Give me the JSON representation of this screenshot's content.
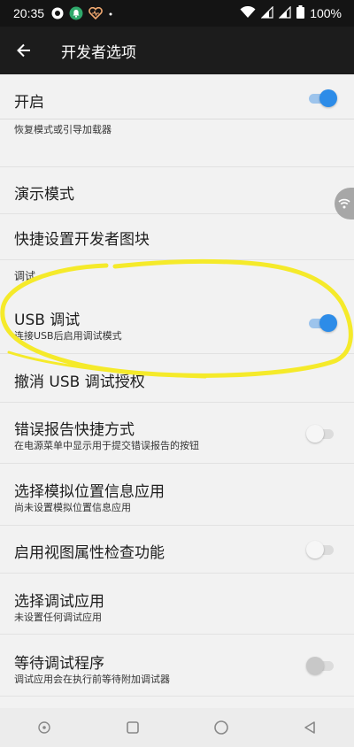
{
  "status_bar": {
    "time": "20:35",
    "battery": "100%"
  },
  "app_bar": {
    "title": "开发者选项"
  },
  "settings": {
    "enable": {
      "title": "开启",
      "on": true
    },
    "recovery_fragment": "恢复模式或引导加载器",
    "demo_mode": {
      "title": "演示模式"
    },
    "quick_tiles": {
      "title": "快捷设置开发者图块"
    },
    "debug_section": "调试",
    "usb_debug": {
      "title": "USB 调试",
      "summary": "连接USB后启用调试模式",
      "on": true
    },
    "revoke_usb": {
      "title": "撤消 USB 调试授权"
    },
    "bug_report": {
      "title": "错误报告快捷方式",
      "summary": "在电源菜单中显示用于提交错误报告的按钮",
      "on": false
    },
    "mock_location": {
      "title": "选择模拟位置信息应用",
      "summary": "尚未设置模拟位置信息应用"
    },
    "view_attr": {
      "title": "启用视图属性检查功能",
      "on": false
    },
    "debug_app": {
      "title": "选择调试应用",
      "summary": "未设置任何调试应用"
    },
    "wait_debugger": {
      "title": "等待调试程序",
      "summary": "调试应用会在执行前等待附加调试器",
      "on": false
    }
  },
  "colors": {
    "accent": "#2d8ce8",
    "annotation": "#f5ea2a",
    "app_bar": "#1c1c1c"
  },
  "icons": [
    "shield-icon",
    "notification-icon",
    "heart-icon",
    "wifi-icon",
    "signal-icon",
    "battery-icon",
    "back-arrow-icon"
  ]
}
